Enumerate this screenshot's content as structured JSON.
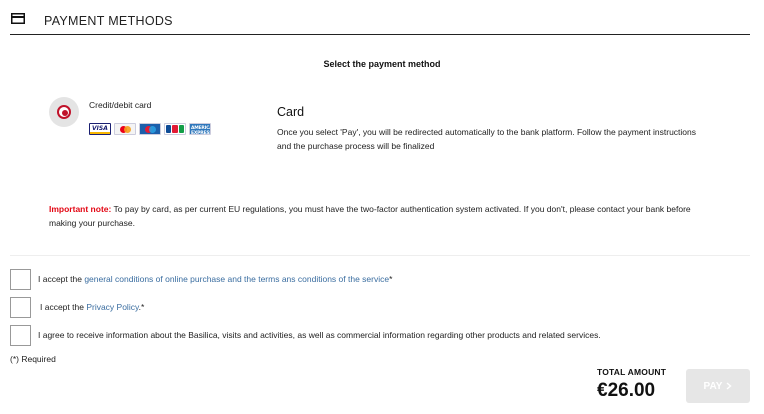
{
  "header": {
    "title": "PAYMENT METHODS",
    "icon": "credit-card-icon"
  },
  "subtitle": "Select the payment method",
  "payment_option": {
    "label": "Credit/debit card",
    "selected": true,
    "accent_color": "#c0122a",
    "brands": [
      "VISA",
      "Mastercard",
      "Maestro",
      "JCB",
      "American Express"
    ]
  },
  "card_info": {
    "title": "Card",
    "description": "Once you select 'Pay', you will be redirected automatically to the bank platform. Follow the payment instructions and the purchase process will be finalized"
  },
  "note": {
    "label": "Important note:",
    "text": " To pay by card, as per current EU regulations, you must have the two-factor authentication system activated. If you don't, please contact your bank before making your purchase."
  },
  "checkboxes": [
    {
      "prefix": "I accept the ",
      "link": "general conditions of online purchase and the terms ans conditions of the service",
      "suffix": "*",
      "checked": false
    },
    {
      "prefix": "I accept the ",
      "link": "Privacy Policy",
      "suffix": ".*",
      "checked": false
    },
    {
      "prefix": "I agree to receive information about the Basilica, visits and activities, as well as commercial information regarding other products and related services.",
      "link": "",
      "suffix": "",
      "checked": false
    }
  ],
  "required_note": "(*) Required",
  "total": {
    "label": "TOTAL AMOUNT",
    "value": "€26.00"
  },
  "pay_button": {
    "label": "PAY",
    "icon": "chevron-right-icon",
    "enabled": false
  }
}
